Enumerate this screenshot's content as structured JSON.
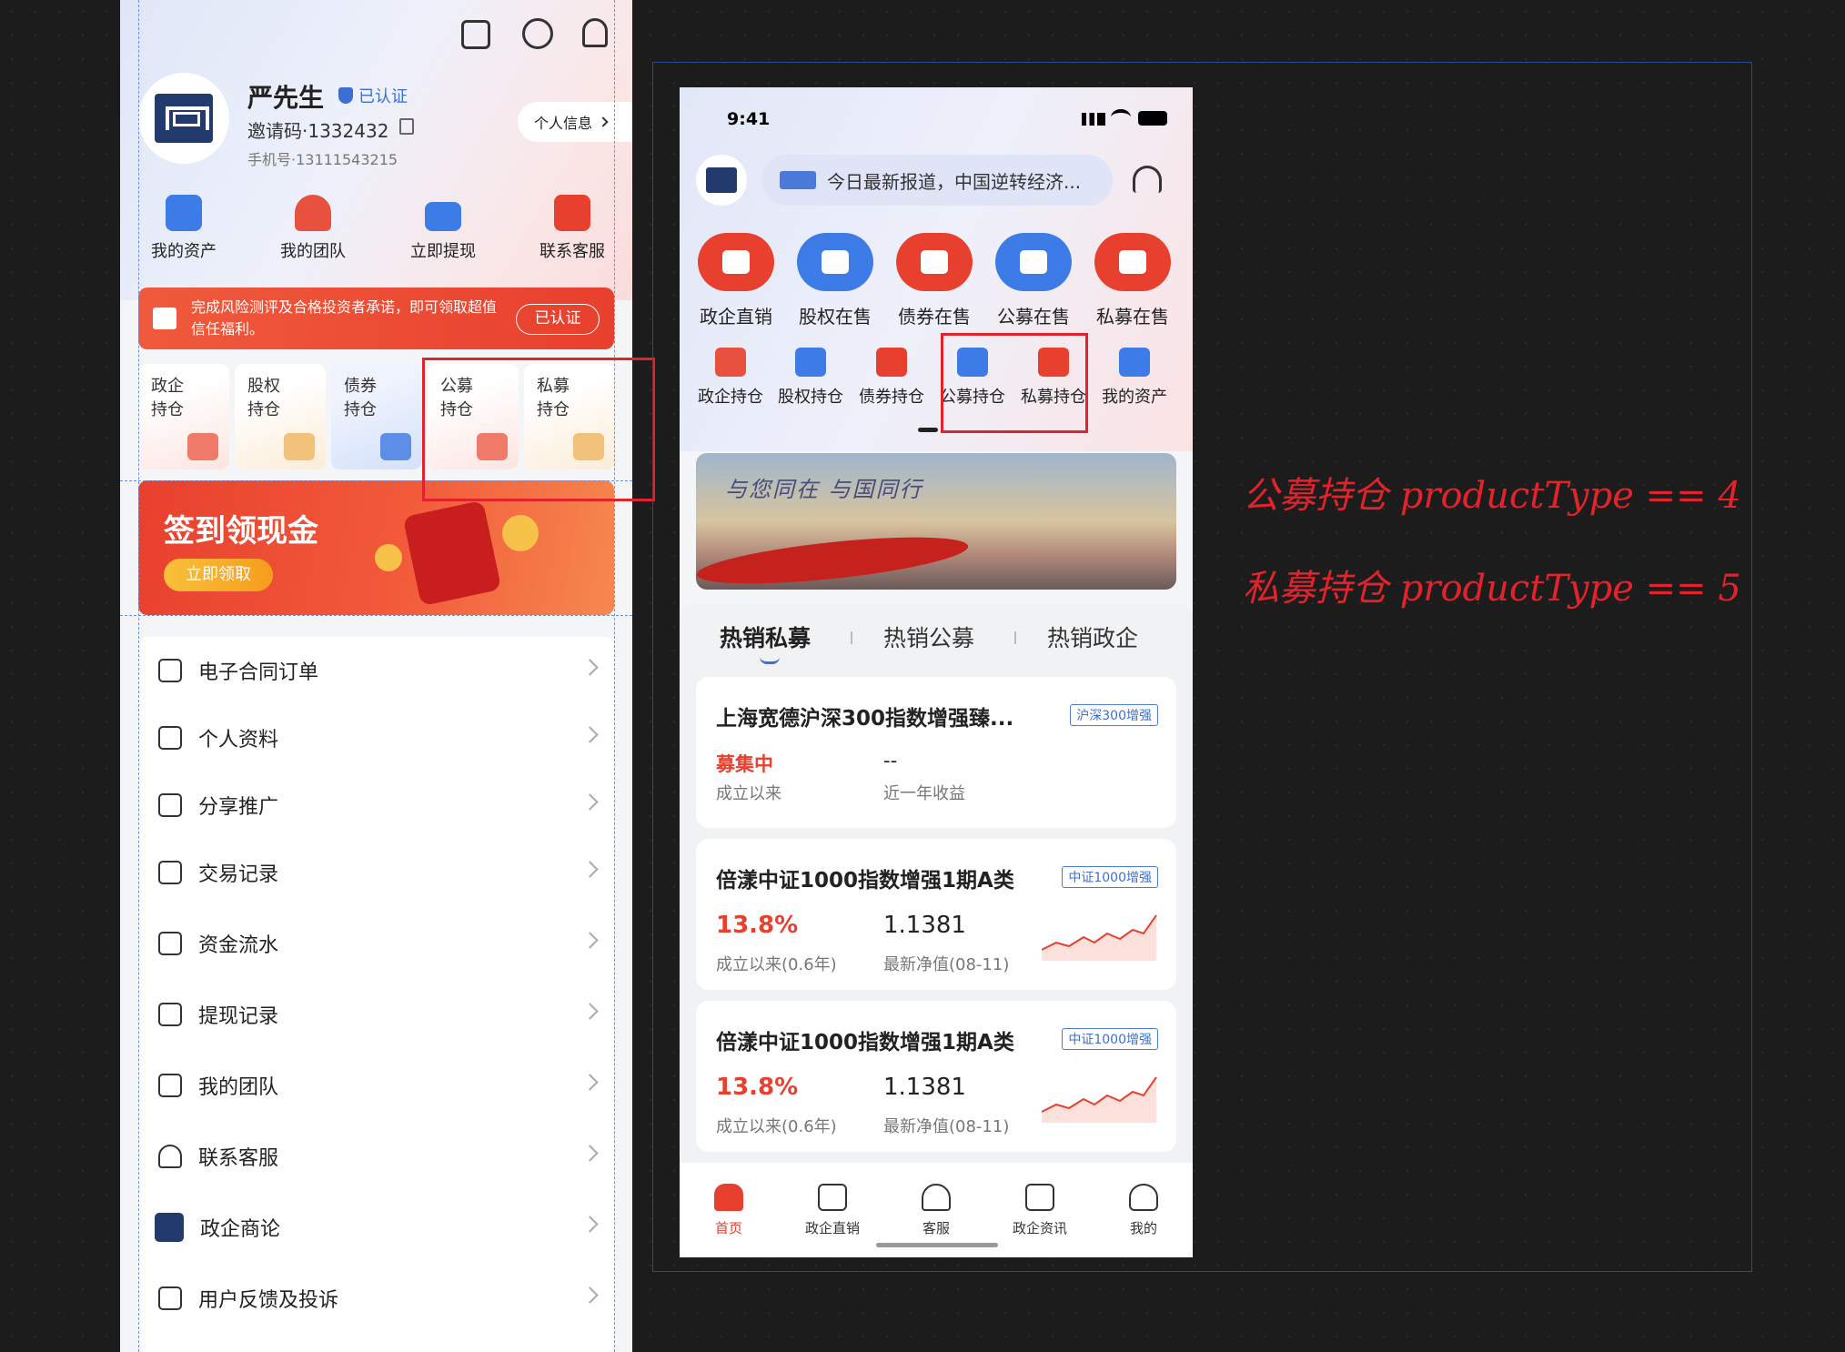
{
  "left": {
    "top_icons": [
      "scan-icon",
      "settings-icon",
      "bell-icon"
    ],
    "user": {
      "name": "严先生",
      "verified": "已认证",
      "invite": "邀请码·1332432",
      "phone": "手机号·13111543215",
      "profile_btn": "个人信息"
    },
    "quick": [
      "我的资产",
      "我的团队",
      "立即提现",
      "联系客服"
    ],
    "notice": {
      "text": "完成风险测评及合格投资者承诺，即可领取超值信任福利。",
      "btn": "已认证"
    },
    "holdings": [
      {
        "l1": "政企",
        "l2": "持仓"
      },
      {
        "l1": "股权",
        "l2": "持仓"
      },
      {
        "l1": "债券",
        "l2": "持仓"
      },
      {
        "l1": "公募",
        "l2": "持仓"
      },
      {
        "l1": "私募",
        "l2": "持仓"
      }
    ],
    "banner": {
      "title": "签到领现金",
      "btn": "立即领取"
    },
    "menu": [
      "电子合同订单",
      "个人资料",
      "分享推广",
      "交易记录",
      "资金流水",
      "提现记录",
      "我的团队",
      "联系客服",
      "政企商论",
      "用户反馈及投诉"
    ]
  },
  "right": {
    "status": {
      "time": "9:41"
    },
    "search": {
      "text": "今日最新报道，中国逆转经济..."
    },
    "sale": [
      "政企直销",
      "股权在售",
      "债券在售",
      "公募在售",
      "私募在售"
    ],
    "sale_colors": [
      "#e8402e",
      "#3d7be6",
      "#e8402e",
      "#3d7be6",
      "#e8402e"
    ],
    "holdings": [
      "政企持仓",
      "股权持仓",
      "债券持仓",
      "公募持仓",
      "私募持仓",
      "我的资产"
    ],
    "banner": {
      "slogan": "与您同在 与国同行"
    },
    "tabs": [
      "热销私募",
      "热销公募",
      "热销政企"
    ],
    "cards": [
      {
        "title": "上海宽德沪深300指数增强臻...",
        "tag": "沪深300增强",
        "v1": "募集中",
        "v2": "--",
        "l1": "成立以来",
        "l2": "近一年收益"
      },
      {
        "title": "倍漾中证1000指数增强1期A类",
        "tag": "中证1000增强",
        "v1": "13.8%",
        "v2": "1.1381",
        "l1": "成立以来(0.6年)",
        "l2": "最新净值(08-11)"
      },
      {
        "title": "倍漾中证1000指数增强1期A类",
        "tag": "中证1000增强",
        "v1": "13.8%",
        "v2": "1.1381",
        "l1": "成立以来(0.6年)",
        "l2": "最新净值(08-11)"
      }
    ],
    "tabbar": [
      "首页",
      "政企直销",
      "客服",
      "政企资讯",
      "我的"
    ]
  },
  "notes": {
    "n1": "公募持仓 productType == 4",
    "n2": "私募持仓 productType == 5"
  }
}
